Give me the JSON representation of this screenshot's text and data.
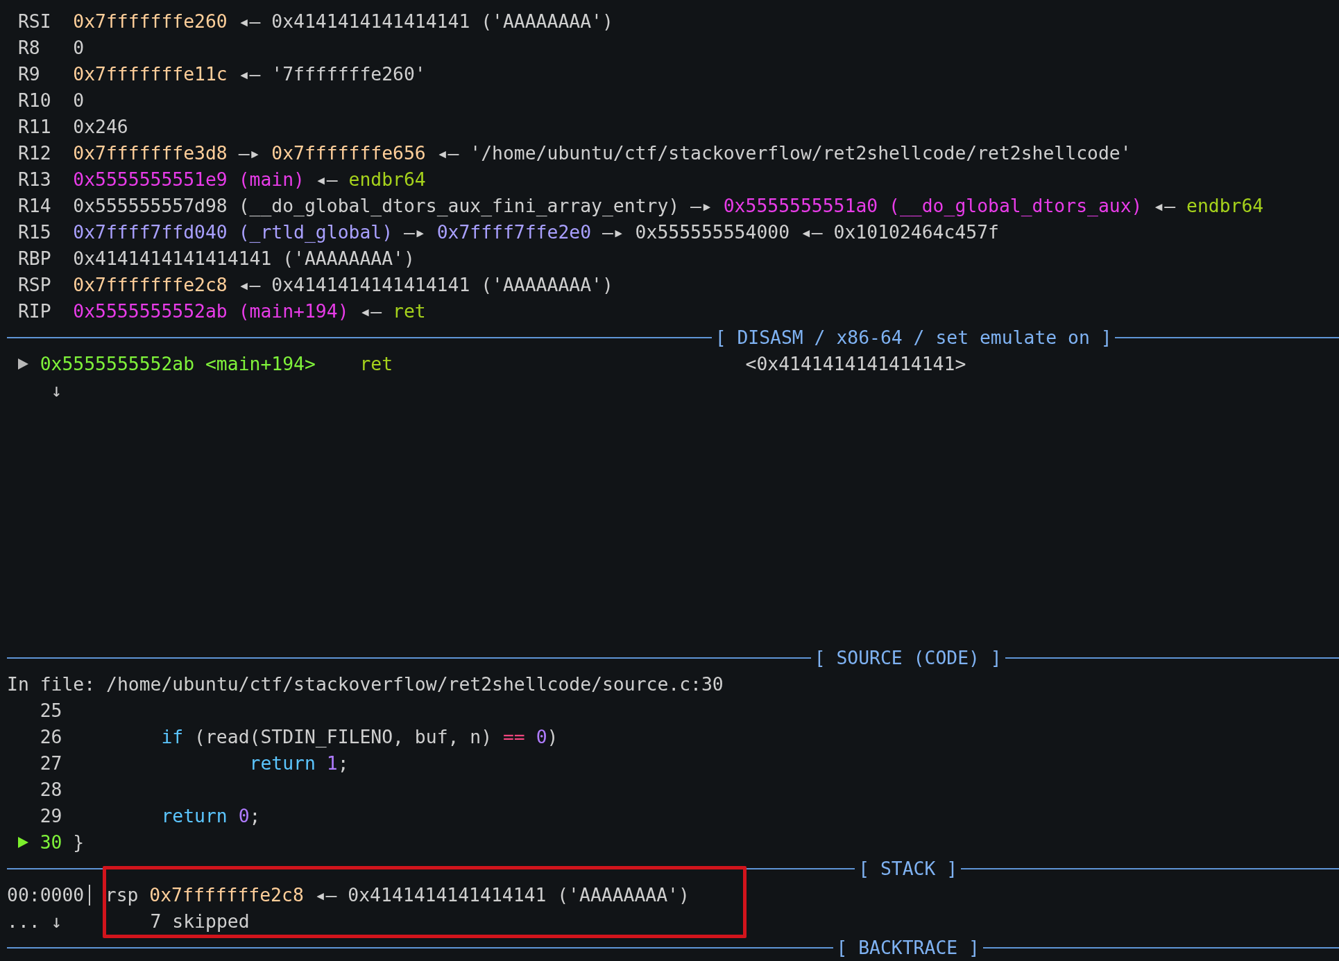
{
  "registers": [
    {
      "name": "RSI",
      "parts": [
        {
          "text": "0x7fffffffe260",
          "kind": "stack"
        },
        {
          "text": "◂—",
          "kind": "arrow"
        },
        {
          "text": "0x4141414141414141 ('AAAAAAAA')",
          "kind": "plain"
        }
      ]
    },
    {
      "name": "R8",
      "parts": [
        {
          "text": "0",
          "kind": "plain"
        }
      ]
    },
    {
      "name": "R9",
      "parts": [
        {
          "text": "0x7fffffffe11c",
          "kind": "stack"
        },
        {
          "text": "◂—",
          "kind": "arrow"
        },
        {
          "text": "'7fffffffe260'",
          "kind": "plain"
        }
      ]
    },
    {
      "name": "R10",
      "parts": [
        {
          "text": "0",
          "kind": "plain"
        }
      ]
    },
    {
      "name": "R11",
      "parts": [
        {
          "text": "0x246",
          "kind": "plain"
        }
      ]
    },
    {
      "name": "R12",
      "parts": [
        {
          "text": "0x7fffffffe3d8",
          "kind": "stack"
        },
        {
          "text": "—▸",
          "kind": "arrow"
        },
        {
          "text": "0x7fffffffe656",
          "kind": "stack"
        },
        {
          "text": "◂—",
          "kind": "arrow"
        },
        {
          "text": "'/home/ubuntu/ctf/stackoverflow/ret2shellcode/ret2shellcode'",
          "kind": "plain"
        }
      ]
    },
    {
      "name": "R13",
      "parts": [
        {
          "text": "0x5555555551e9 (main)",
          "kind": "code"
        },
        {
          "text": "◂—",
          "kind": "arrow"
        },
        {
          "text": "endbr64",
          "kind": "insn"
        }
      ]
    },
    {
      "name": "R14",
      "parts": [
        {
          "text": "0x555555557d98 (__do_global_dtors_aux_fini_array_entry)",
          "kind": "plain"
        },
        {
          "text": "—▸",
          "kind": "arrow"
        },
        {
          "text": "0x5555555551a0 (__do_global_dtors_aux)",
          "kind": "code"
        },
        {
          "text": "◂—",
          "kind": "arrow"
        },
        {
          "text": "endbr64",
          "kind": "insn"
        }
      ]
    },
    {
      "name": "R15",
      "parts": [
        {
          "text": "0x7ffff7ffd040 (_rtld_global)",
          "kind": "data"
        },
        {
          "text": "—▸",
          "kind": "arrow"
        },
        {
          "text": "0x7ffff7ffe2e0",
          "kind": "data"
        },
        {
          "text": "—▸",
          "kind": "arrow"
        },
        {
          "text": "0x555555554000",
          "kind": "plain"
        },
        {
          "text": "◂—",
          "kind": "arrow"
        },
        {
          "text": "0x10102464c457f",
          "kind": "plain"
        }
      ]
    },
    {
      "name": "RBP",
      "parts": [
        {
          "text": "0x4141414141414141 ('AAAAAAAA')",
          "kind": "plain"
        }
      ]
    },
    {
      "name": "RSP",
      "parts": [
        {
          "text": "0x7fffffffe2c8",
          "kind": "stack"
        },
        {
          "text": "◂—",
          "kind": "arrow"
        },
        {
          "text": "0x4141414141414141 ('AAAAAAAA')",
          "kind": "plain"
        }
      ]
    },
    {
      "name": "RIP",
      "parts": [
        {
          "text": "0x5555555552ab (main+194)",
          "kind": "code"
        },
        {
          "text": "◂—",
          "kind": "arrow"
        },
        {
          "text": "ret",
          "kind": "insn"
        }
      ]
    }
  ],
  "disasm": {
    "title": "[ DISASM / x86-64 / set emulate on ]",
    "lines": [
      {
        "kind": "instruction",
        "current": true,
        "address": "0x5555555552ab <main+194>",
        "mnemonic": "ret",
        "operand": "<0x4141414141414141>"
      },
      {
        "kind": "continuation",
        "current": false,
        "text": "↓"
      }
    ]
  },
  "source": {
    "title": "[ SOURCE (CODE) ]",
    "file": "In file: /home/ubuntu/ctf/stackoverflow/ret2shellcode/source.c:30",
    "lines": [
      {
        "number": "25",
        "current": false
      },
      {
        "number": "26",
        "current": false,
        "code": [
          {
            "text": "        if",
            "kind": "keyword"
          },
          {
            "text": " (read(STDIN_FILENO, buf, n) ",
            "kind": "plain"
          },
          {
            "text": "==",
            "kind": "operator"
          },
          {
            "text": " 0",
            "kind": "number"
          },
          {
            "text": ")",
            "kind": "plain"
          }
        ]
      },
      {
        "number": "27",
        "current": false,
        "code": [
          {
            "text": "                return ",
            "kind": "keyword"
          },
          {
            "text": "1",
            "kind": "number"
          },
          {
            "text": ";",
            "kind": "plain"
          }
        ]
      },
      {
        "number": "28",
        "current": false
      },
      {
        "number": "29",
        "current": false,
        "code": [
          {
            "text": "        return ",
            "kind": "keyword"
          },
          {
            "text": "0",
            "kind": "number"
          },
          {
            "text": ";",
            "kind": "plain"
          }
        ]
      },
      {
        "number": "30",
        "current": true,
        "code": [
          {
            "text": "}",
            "kind": "plain"
          }
        ]
      }
    ]
  },
  "stack": {
    "title": "[ STACK ]",
    "highlighted": true,
    "lines": [
      {
        "kind": "entry",
        "offset": "00:0000",
        "register": "rsp",
        "address": "0x7fffffffe2c8",
        "arrow": "◂—",
        "value": "0x4141414141414141 ('AAAAAAAA')"
      },
      {
        "kind": "skip",
        "offset": "... ↓",
        "text": "7 skipped"
      }
    ]
  },
  "backtrace": {
    "title": "[ BACKTRACE ]"
  }
}
